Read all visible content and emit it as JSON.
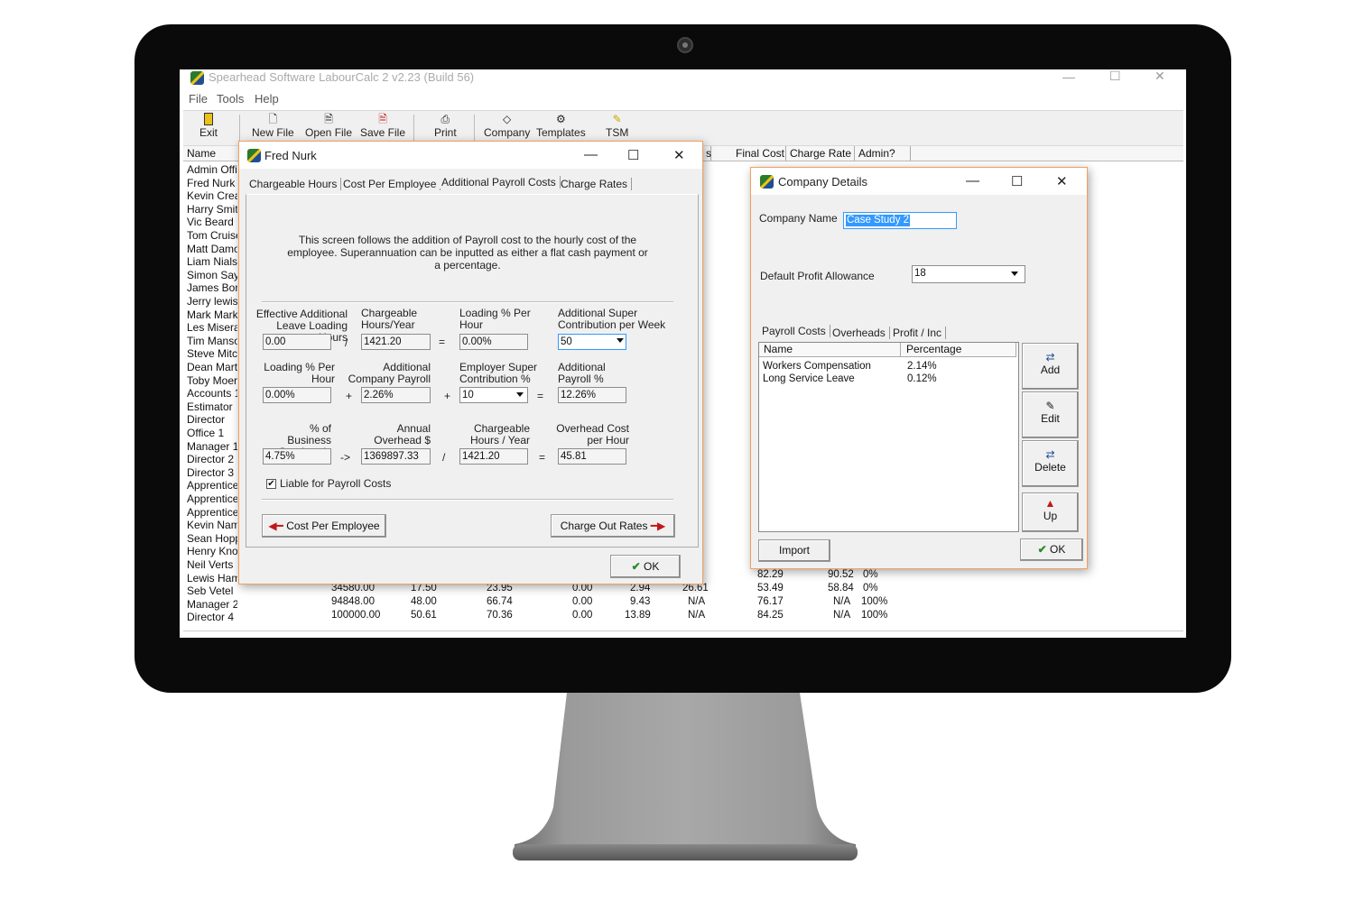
{
  "app": {
    "title": "Spearhead Software LabourCalc 2 v2.23 (Build 56)",
    "menu": [
      "File",
      "Tools",
      "Help"
    ],
    "toolbar": [
      {
        "label": "Exit",
        "icon": "exit-icon"
      },
      {
        "label": "New File",
        "icon": "new-file-icon"
      },
      {
        "label": "Open File",
        "icon": "open-file-icon"
      },
      {
        "label": "Save File",
        "icon": "save-file-icon"
      },
      {
        "label": "Print",
        "icon": "print-icon"
      },
      {
        "label": "Company",
        "icon": "company-icon"
      },
      {
        "label": "Templates",
        "icon": "templates-icon"
      },
      {
        "label": "TSM",
        "icon": "tsm-icon"
      }
    ],
    "grid": {
      "headers": {
        "name": "Name",
        "s": "s",
        "final_cost": "Final Cost",
        "charge_rate": "Charge Rate",
        "admin": "Admin?"
      },
      "names": [
        "Admin Offic",
        "Fred Nurk",
        "Kevin Crea",
        "Harry Smith",
        "Vic Beard",
        "Tom Cruise",
        "Matt Damo",
        "Liam Nials",
        "Simon Say",
        "James Bor",
        "Jerry lewis",
        "Mark Marke",
        "Les Misera",
        "Tim Manso",
        "Steve Mitch",
        "Dean Marti",
        "Toby Moer",
        "Accounts 1",
        "Estimator",
        "Director",
        "Office 1",
        "Manager 1",
        "Director 2",
        "Director 3",
        "Apprentice",
        "Apprentice",
        "Apprentice",
        "Kevin Nam",
        "Sean Hopp",
        "Henry Knob",
        "Neil Verts",
        "Lewis Ham",
        "Seb Vetel",
        "Manager 2",
        "Director 4"
      ],
      "visible_rows": [
        {
          "name": "Lewis Ham",
          "final_cost": "82.29",
          "charge_rate": "90.52",
          "admin": "0%"
        },
        {
          "name": "Seb Vetel",
          "c1": "34580.00",
          "c2": "17.50",
          "c3": "23.95",
          "c4": "0.00",
          "c5": "2.94",
          "c6": "26.61",
          "final_cost": "53.49",
          "charge_rate": "58.84",
          "admin": "0%"
        },
        {
          "name": "Manager 2",
          "c1": "94848.00",
          "c2": "48.00",
          "c3": "66.74",
          "c4": "0.00",
          "c5": "9.43",
          "c6": "N/A",
          "final_cost": "76.17",
          "charge_rate": "N/A",
          "admin": "100%"
        },
        {
          "name": "Director 4",
          "c1": "100000.00",
          "c2": "50.61",
          "c3": "70.36",
          "c4": "0.00",
          "c5": "13.89",
          "c6": "N/A",
          "final_cost": "84.25",
          "charge_rate": "N/A",
          "admin": "100%"
        }
      ]
    }
  },
  "employee_dialog": {
    "title": "Fred Nurk",
    "tabs": [
      "Chargeable Hours",
      "Cost Per Employee",
      "Additional Payroll Costs",
      "Charge Rates"
    ],
    "active_tab": "Additional Payroll Costs",
    "description": "This screen follows the addition of Payroll cost to the hourly cost of the employee.  Superannuation can be inputted as either a flat cash payment or a percentage.",
    "row1": {
      "l1": "Effective Additional Leave Loading Hours",
      "v1": "0.00",
      "op1": "/",
      "l2": "Chargeable Hours/Year",
      "v2": "1421.20",
      "op2": "=",
      "l3": "Loading % Per Hour",
      "v3": "0.00%",
      "l4": "Additional Super Contribution per Week",
      "v4": "50"
    },
    "row2": {
      "l1": "Loading % Per Hour",
      "v1": "0.00%",
      "op1": "+",
      "l2": "Additional Company Payroll",
      "v2": "2.26%",
      "op2": "+",
      "l3": "Employer Super Contribution %",
      "v3": "10",
      "op3": "=",
      "l4": "Additional Payroll %",
      "v4": "12.26%"
    },
    "row3": {
      "l1": "% of Business Overheads",
      "v1": "4.75%",
      "op1": "->",
      "l2": "Annual Overhead $",
      "v2": "1369897.33",
      "op2": "/",
      "l3": "Chargeable Hours / Year",
      "v3": "1421.20",
      "op3": "=",
      "l4": "Overhead Cost per Hour",
      "v4": "45.81"
    },
    "checkbox_label": "Liable for Payroll Costs",
    "checkbox_checked": true,
    "prev_button": "Cost Per Employee",
    "next_button": "Charge Out Rates",
    "ok_button": "OK"
  },
  "company_dialog": {
    "title": "Company Details",
    "company_name_label": "Company Name",
    "company_name_value": "Case Study 2",
    "profit_label": "Default Profit Allowance",
    "profit_value": "18",
    "tabs": [
      "Payroll Costs",
      "Overheads",
      "Profit / Inc"
    ],
    "list_headers": [
      "Name",
      "Percentage"
    ],
    "list_rows": [
      {
        "name": "Workers Compensation",
        "pct": "2.14%"
      },
      {
        "name": "Long Service Leave",
        "pct": "0.12%"
      }
    ],
    "side_buttons": [
      "Add",
      "Edit",
      "Delete",
      "Up"
    ],
    "import_button": "Import",
    "ok_button": "OK"
  },
  "colors": {
    "accent_orange": "#f0a060",
    "ok_green": "#2a8a2a",
    "arrow_red": "#c01818",
    "selection_blue": "#3399ff"
  }
}
